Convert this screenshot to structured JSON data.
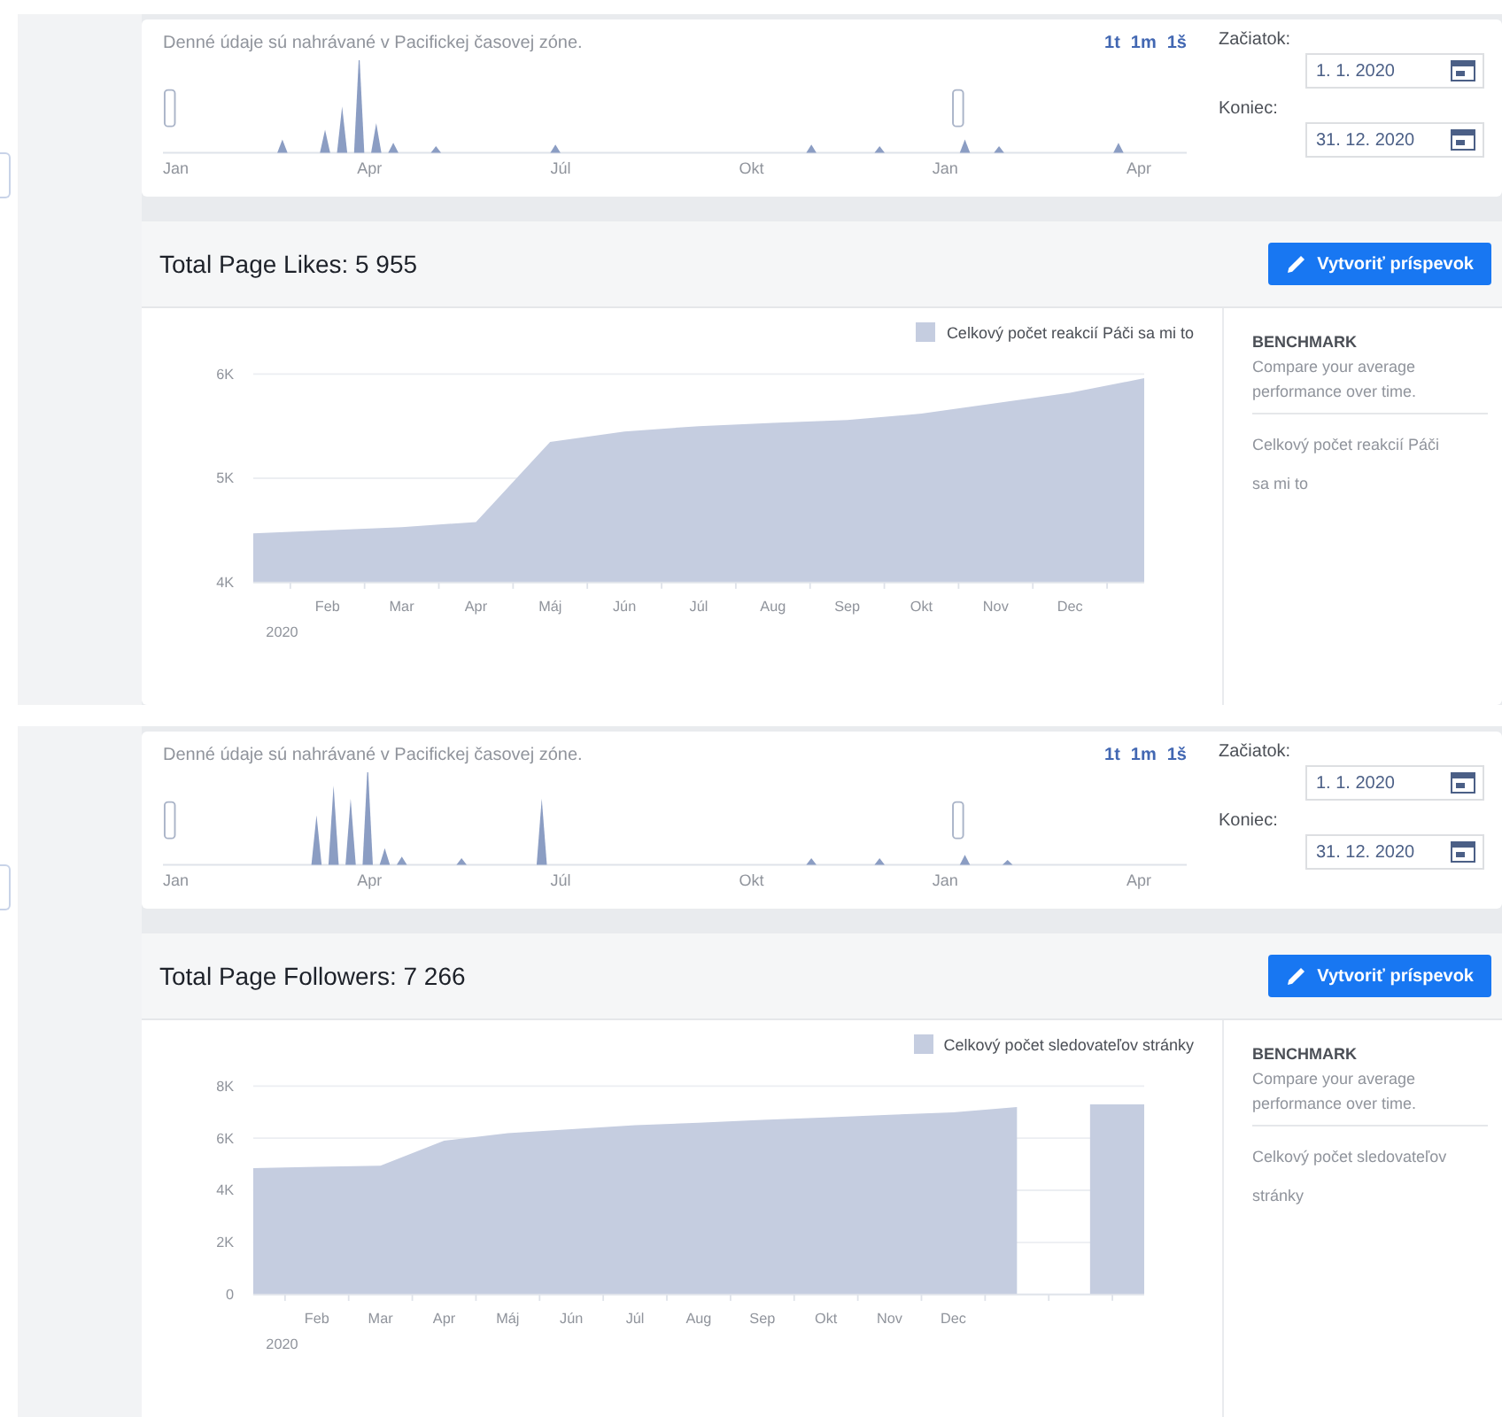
{
  "sections": [
    {
      "overview": {
        "note": "Denné údaje sú nahrávané v Pacifickej časovej zóne.",
        "range_links": [
          "1t",
          "1m",
          "1š"
        ],
        "axis_labels": [
          "Jan",
          "Apr",
          "Júl",
          "Okt",
          "Jan",
          "Apr"
        ],
        "start": {
          "label": "Začiatok:",
          "value": "1. 1. 2020"
        },
        "end": {
          "label": "Koniec:",
          "value": "31. 12. 2020"
        }
      },
      "title": "Total Page Likes: 5 955",
      "button": "Vytvoriť príspevok",
      "chart_data": {
        "type": "area",
        "xlabel": "2020",
        "categories": [
          null,
          "Feb",
          "Mar",
          "Apr",
          "Máj",
          "Jún",
          "Júl",
          "Aug",
          "Sep",
          "Okt",
          "Nov",
          "Dec",
          null
        ],
        "series": [
          {
            "name": "Celkový počet reakcií Páči sa mi to",
            "color": "#c5cde0",
            "values": [
              4470,
              4500,
              4530,
              4580,
              5350,
              5450,
              5500,
              5530,
              5560,
              5620,
              5720,
              5820,
              5960
            ]
          }
        ],
        "ylim": [
          4000,
          6000
        ],
        "grid": true,
        "yticks": [
          {
            "value": 4000,
            "label": "4K"
          },
          {
            "value": 5000,
            "label": "5K"
          },
          {
            "value": 6000,
            "label": "6K"
          }
        ]
      },
      "benchmark": {
        "title": "BENCHMARK",
        "text": "Compare your average performance over time.",
        "metric": "Celkový počet reakcií Páči sa mi to"
      }
    },
    {
      "overview": {
        "note": "Denné údaje sú nahrávané v Pacifickej časovej zóne.",
        "range_links": [
          "1t",
          "1m",
          "1š"
        ],
        "axis_labels": [
          "Jan",
          "Apr",
          "Júl",
          "Okt",
          "Jan",
          "Apr"
        ],
        "start": {
          "label": "Začiatok:",
          "value": "1. 1. 2020"
        },
        "end": {
          "label": "Koniec:",
          "value": "31. 12. 2020"
        }
      },
      "title": "Total Page Followers: 7 266",
      "button": "Vytvoriť príspevok",
      "chart_data": {
        "type": "area",
        "xlabel": "2020",
        "categories": [
          null,
          "Feb",
          "Mar",
          "Apr",
          "Máj",
          "Jún",
          "Júl",
          "Aug",
          "Sep",
          "Okt",
          "Nov",
          "Dec",
          null,
          null,
          null
        ],
        "series": [
          {
            "name": "Celkový počet sledovateľov stránky",
            "color": "#c5cde0",
            "values": [
              4850,
              4900,
              4950,
              5900,
              6200,
              6350,
              6500,
              6600,
              6700,
              6800,
              6900,
              7000,
              7200,
              null,
              7300
            ]
          }
        ],
        "ylim": [
          0,
          8000
        ],
        "grid": true,
        "yticks": [
          {
            "value": 0,
            "label": "0"
          },
          {
            "value": 2000,
            "label": "2K"
          },
          {
            "value": 4000,
            "label": "4K"
          },
          {
            "value": 6000,
            "label": "6K"
          },
          {
            "value": 8000,
            "label": "8K"
          }
        ]
      },
      "benchmark": {
        "title": "BENCHMARK",
        "text": "Compare your average performance over time.",
        "metric": "Celkový počet sledovateľov stránky"
      }
    }
  ]
}
